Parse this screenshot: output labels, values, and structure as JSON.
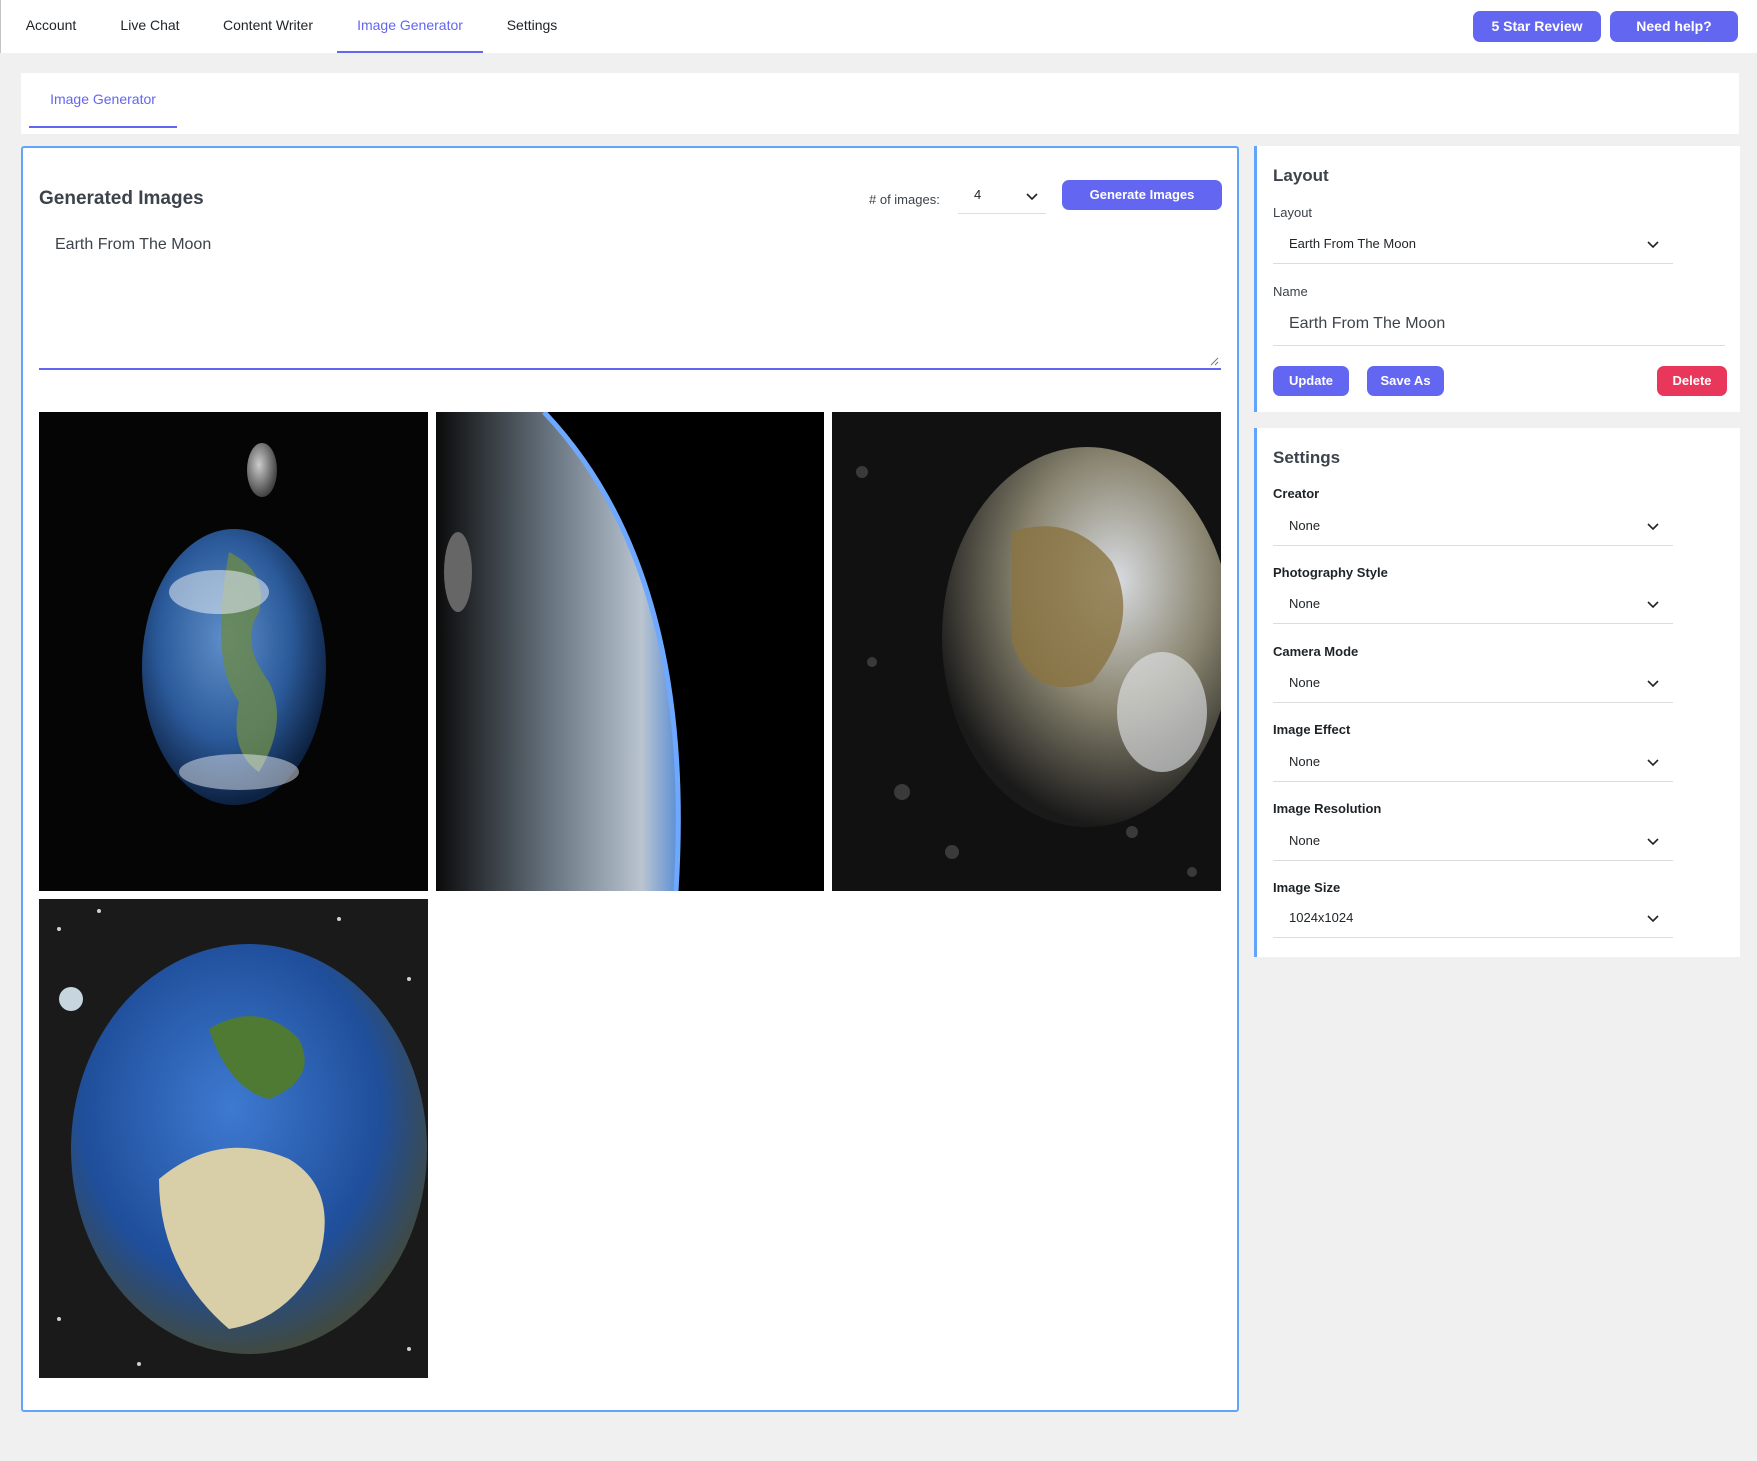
{
  "nav": {
    "tabs": [
      {
        "label": "Account"
      },
      {
        "label": "Live Chat"
      },
      {
        "label": "Content Writer"
      },
      {
        "label": "Image Generator"
      },
      {
        "label": "Settings"
      }
    ],
    "active_tab": "Image Generator",
    "review_button": "5 Star Review",
    "help_button": "Need help?"
  },
  "subnav": {
    "tab": "Image Generator"
  },
  "generator": {
    "heading": "Generated Images",
    "count_label": "# of images:",
    "count_value": "4",
    "generate_button": "Generate Images",
    "prompt": "Earth From The Moon",
    "images": [
      {
        "description": "earth-with-moon-above"
      },
      {
        "description": "earth-limb-closeup"
      },
      {
        "description": "earth-asia-view"
      },
      {
        "description": "earth-europe-africa-view"
      }
    ]
  },
  "layout_panel": {
    "title": "Layout",
    "layout_label": "Layout",
    "layout_value": "Earth From The Moon",
    "name_label": "Name",
    "name_value": "Earth From The Moon",
    "update_button": "Update",
    "save_as_button": "Save As",
    "delete_button": "Delete"
  },
  "settings_panel": {
    "title": "Settings",
    "fields": [
      {
        "label": "Creator",
        "value": "None"
      },
      {
        "label": "Photography Style",
        "value": "None"
      },
      {
        "label": "Camera Mode",
        "value": "None"
      },
      {
        "label": "Image Effect",
        "value": "None"
      },
      {
        "label": "Image Resolution",
        "value": "None"
      },
      {
        "label": "Image Size",
        "value": "1024x1024"
      }
    ]
  },
  "colors": {
    "accent": "#6366f1",
    "panel_border": "#60a5fa",
    "delete": "#e8375a",
    "page_bg": "#f0f0f1"
  }
}
